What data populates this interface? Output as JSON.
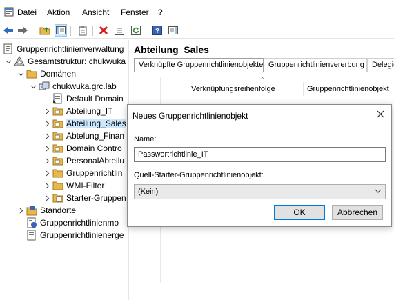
{
  "menu": {
    "items": [
      "Datei",
      "Aktion",
      "Ansicht",
      "Fenster",
      "?"
    ]
  },
  "toolbar": {
    "icons": [
      "back-icon",
      "forward-icon",
      "up-folder-icon",
      "show-hide-tree-icon",
      "clipboard-icon",
      "delete-icon",
      "properties-icon",
      "refresh-icon",
      "help-icon",
      "action-pane-icon"
    ]
  },
  "tree": {
    "root": "Gruppenrichtlinienverwaltung",
    "forest": "Gesamtstruktur: chukwuka",
    "domains": "Domänen",
    "domain": "chukwuka.grc.lab",
    "children": [
      "Default Domain",
      "Abteilung_IT",
      "Abteilung_Sales",
      "Abtelung_Finan",
      "Domain Contro",
      "PersonalAbteilu",
      "Gruppenrichtlin",
      "WMI-Filter",
      "Starter-Gruppen"
    ],
    "sites": "Standorte",
    "modeling": "Gruppenrichtlinienmo",
    "results": "Gruppenrichtlinienerge"
  },
  "right": {
    "title": "Abteilung_Sales",
    "tabs": [
      "Verknüpfte Gruppenrichtlinienobjekte",
      "Gruppenrichtlinienvererbung",
      "Delegie"
    ],
    "columns": [
      "Verknüpfungsreihenfolge",
      "Gruppenrichtlinienobjekt"
    ]
  },
  "dialog": {
    "title": "Neues Gruppenrichtlinienobjekt",
    "name_label": "Name:",
    "name_value": "Passwortrichtlinie_IT",
    "starter_label": "Quell-Starter-Gruppenrichtlinienobjekt:",
    "starter_value": "(Kein)",
    "ok_label": "OK",
    "cancel_label": "Abbrechen"
  },
  "colors": {
    "selection": "#cce8ff",
    "accent": "#0078d7",
    "folder": "#e8b84a"
  }
}
